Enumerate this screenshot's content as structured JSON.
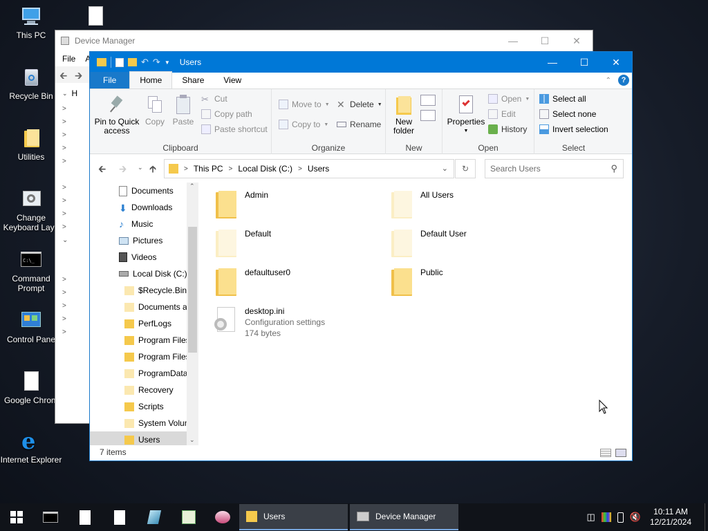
{
  "desktop": {
    "icons": [
      {
        "label": "This PC",
        "icon": "this-pc-icon"
      },
      {
        "label": "",
        "icon": "file-icon"
      },
      {
        "label": "Recycle Bin",
        "icon": "recycle-bin-icon"
      },
      {
        "label": "Utilities",
        "icon": "folder-icon"
      },
      {
        "label": "Change Keyboard Layo",
        "icon": "keyboard-settings-icon"
      },
      {
        "label": "Command Prompt",
        "icon": "command-prompt-icon"
      },
      {
        "label": "Control Pane",
        "icon": "control-panel-icon"
      },
      {
        "label": "Google Chrom",
        "icon": "file-icon"
      },
      {
        "label": "Internet Explorer",
        "icon": "internet-explorer-icon"
      }
    ]
  },
  "device_manager": {
    "title": "Device Manager",
    "menu": [
      "File",
      "A"
    ],
    "tree_first": "H"
  },
  "explorer": {
    "title": "Users",
    "tabs": {
      "file": "File",
      "home": "Home",
      "share": "Share",
      "view": "View"
    },
    "ribbon": {
      "clipboard": {
        "name": "Clipboard",
        "pin": "Pin to Quick access",
        "pin_line1": "Pin to Quick",
        "pin_line2": "access",
        "copy": "Copy",
        "paste": "Paste",
        "cut": "Cut",
        "copy_path": "Copy path",
        "paste_shortcut": "Paste shortcut"
      },
      "organize": {
        "name": "Organize",
        "move_to": "Move to",
        "copy_to": "Copy to",
        "delete": "Delete",
        "rename": "Rename"
      },
      "new": {
        "name": "New",
        "new_folder_line1": "New",
        "new_folder_line2": "folder"
      },
      "open": {
        "name": "Open",
        "properties": "Properties",
        "open": "Open",
        "edit": "Edit",
        "history": "History"
      },
      "select": {
        "name": "Select",
        "select_all": "Select all",
        "select_none": "Select none",
        "invert": "Invert selection"
      }
    },
    "address": {
      "crumbs": [
        "This PC",
        "Local Disk (C:)",
        "Users"
      ],
      "search_placeholder": "Search Users"
    },
    "nav": [
      {
        "label": "Documents",
        "icon": "documents-icon",
        "indent": 1
      },
      {
        "label": "Downloads",
        "icon": "downloads-icon",
        "indent": 1
      },
      {
        "label": "Music",
        "icon": "music-icon",
        "indent": 1
      },
      {
        "label": "Pictures",
        "icon": "pictures-icon",
        "indent": 1
      },
      {
        "label": "Videos",
        "icon": "videos-icon",
        "indent": 1
      },
      {
        "label": "Local Disk (C:)",
        "icon": "drive-icon",
        "indent": 1
      },
      {
        "label": "$Recycle.Bin",
        "icon": "folder-icon",
        "indent": 2
      },
      {
        "label": "Documents a",
        "icon": "folder-icon",
        "indent": 2
      },
      {
        "label": "PerfLogs",
        "icon": "folder-icon",
        "indent": 2
      },
      {
        "label": "Program Files",
        "icon": "folder-icon",
        "indent": 2
      },
      {
        "label": "Program Files",
        "icon": "folder-icon",
        "indent": 2
      },
      {
        "label": "ProgramData",
        "icon": "folder-icon",
        "indent": 2
      },
      {
        "label": "Recovery",
        "icon": "folder-icon",
        "indent": 2
      },
      {
        "label": "Scripts",
        "icon": "folder-icon",
        "indent": 2
      },
      {
        "label": "System Volun",
        "icon": "folder-icon",
        "indent": 2
      },
      {
        "label": "Users",
        "icon": "folder-icon",
        "indent": 2,
        "selected": true
      }
    ],
    "files": [
      {
        "name": "Admin",
        "type": "folder",
        "faded": false
      },
      {
        "name": "All Users",
        "type": "folder",
        "faded": true
      },
      {
        "name": "Default",
        "type": "folder",
        "faded": true
      },
      {
        "name": "Default User",
        "type": "folder",
        "faded": true
      },
      {
        "name": "defaultuser0",
        "type": "folder",
        "faded": false
      },
      {
        "name": "Public",
        "type": "folder",
        "faded": false
      },
      {
        "name": "desktop.ini",
        "type": "settings-file",
        "detail1": "Configuration settings",
        "detail2": "174 bytes"
      }
    ],
    "status": "7 items"
  },
  "taskbar": {
    "tasks": [
      {
        "label": "Users",
        "icon": "folder-icon"
      },
      {
        "label": "Device Manager",
        "icon": "device-manager-icon"
      }
    ],
    "time": "10:11 AM",
    "date": "12/21/2024"
  },
  "colors": {
    "accent": "#0078d7",
    "folder": "#f5c94c",
    "ribbon_bg": "#f5f6f7"
  }
}
